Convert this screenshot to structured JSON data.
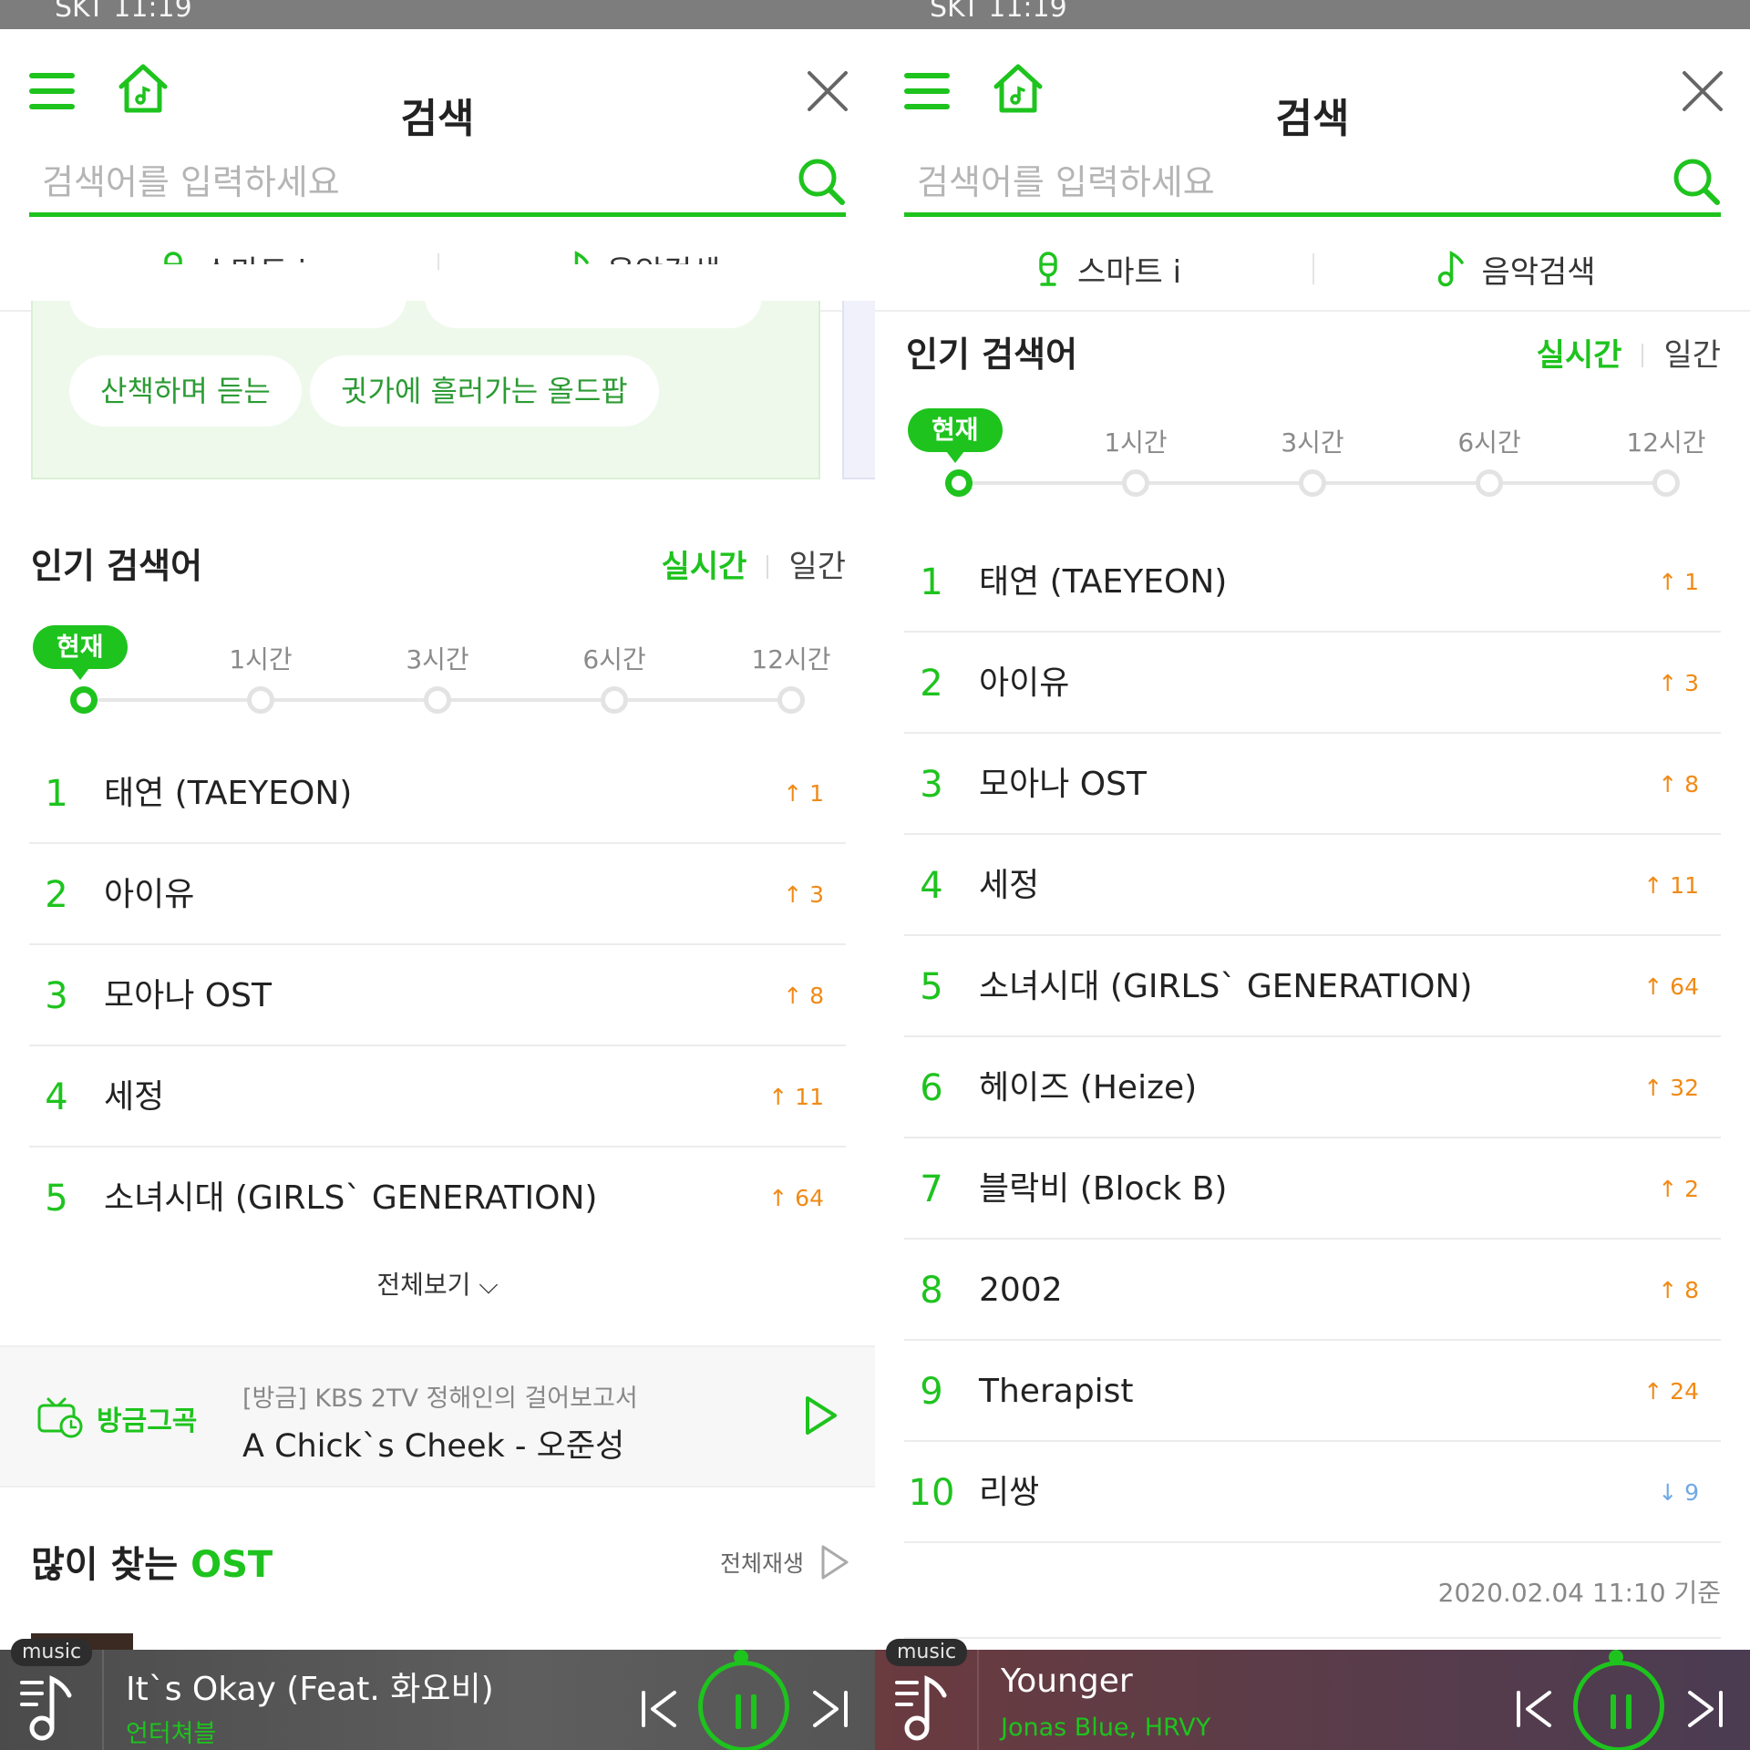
{
  "left": {
    "status_text": "SKT 11:19",
    "title": "검색",
    "search": {
      "placeholder": "검색어를 입력하세요"
    },
    "modes": {
      "smart": "스마트 i",
      "music": "음악검색"
    },
    "tags": [
      "산책하며 듣는",
      "귓가에 흘러가는 올드팝"
    ],
    "popular": {
      "title": "인기 검색어",
      "realtime": "실시간",
      "daily": "일간",
      "timeline": {
        "now": "현재",
        "labels": [
          "1시간",
          "3시간",
          "6시간",
          "12시간"
        ]
      },
      "items": [
        {
          "rank": "1",
          "name": "태연 (TAEYEON)",
          "change": "↑ 1"
        },
        {
          "rank": "2",
          "name": "아이유",
          "change": "↑ 3"
        },
        {
          "rank": "3",
          "name": "모아나 OST",
          "change": "↑ 8"
        },
        {
          "rank": "4",
          "name": "세정",
          "change": "↑ 11"
        },
        {
          "rank": "5",
          "name": "소녀시대 (GIRLS` GENERATION)",
          "change": "↑ 64"
        }
      ],
      "view_all": "전체보기 ⌵"
    },
    "now_playing": {
      "label": "방금그곡",
      "subtitle": "[방금] KBS 2TV 정해인의 걸어보고서",
      "song": "A Chick`s Cheek - 오준성"
    },
    "ost": {
      "title_prefix": "많이 찾는 ",
      "title_accent": "OST",
      "play_all": "전체재생"
    },
    "player": {
      "tag": "music",
      "title": "It`s Okay (Feat. 화요비)",
      "artist": "언터쳐블"
    }
  },
  "right": {
    "status_text": "SKT 11:19",
    "title": "검색",
    "search": {
      "placeholder": "검색어를 입력하세요"
    },
    "modes": {
      "smart": "스마트 i",
      "music": "음악검색"
    },
    "popular": {
      "title": "인기 검색어",
      "realtime": "실시간",
      "daily": "일간",
      "timeline": {
        "now": "현재",
        "labels": [
          "1시간",
          "3시간",
          "6시간",
          "12시간"
        ]
      },
      "items": [
        {
          "rank": "1",
          "name": "태연 (TAEYEON)",
          "change": "↑ 1"
        },
        {
          "rank": "2",
          "name": "아이유",
          "change": "↑ 3"
        },
        {
          "rank": "3",
          "name": "모아나 OST",
          "change": "↑ 8"
        },
        {
          "rank": "4",
          "name": "세정",
          "change": "↑ 11"
        },
        {
          "rank": "5",
          "name": "소녀시대 (GIRLS` GENERATION)",
          "change": "↑ 64"
        },
        {
          "rank": "6",
          "name": "헤이즈 (Heize)",
          "change": "↑ 32"
        },
        {
          "rank": "7",
          "name": "블락비 (Block B)",
          "change": "↑ 2"
        },
        {
          "rank": "8",
          "name": "2002",
          "change": "↑ 8"
        },
        {
          "rank": "9",
          "name": "Therapist",
          "change": "↑ 24"
        },
        {
          "rank": "10",
          "name": "리쌍",
          "change": "↓ 9"
        }
      ],
      "timestamp": "2020.02.04 11:10 기준"
    },
    "player": {
      "tag": "music",
      "title": "Younger",
      "artist": "Jonas Blue, HRVY"
    }
  },
  "colors": {
    "accent": "#1ec31e",
    "rank_up": "#f08a16",
    "rank_down": "#6fa8e6"
  }
}
